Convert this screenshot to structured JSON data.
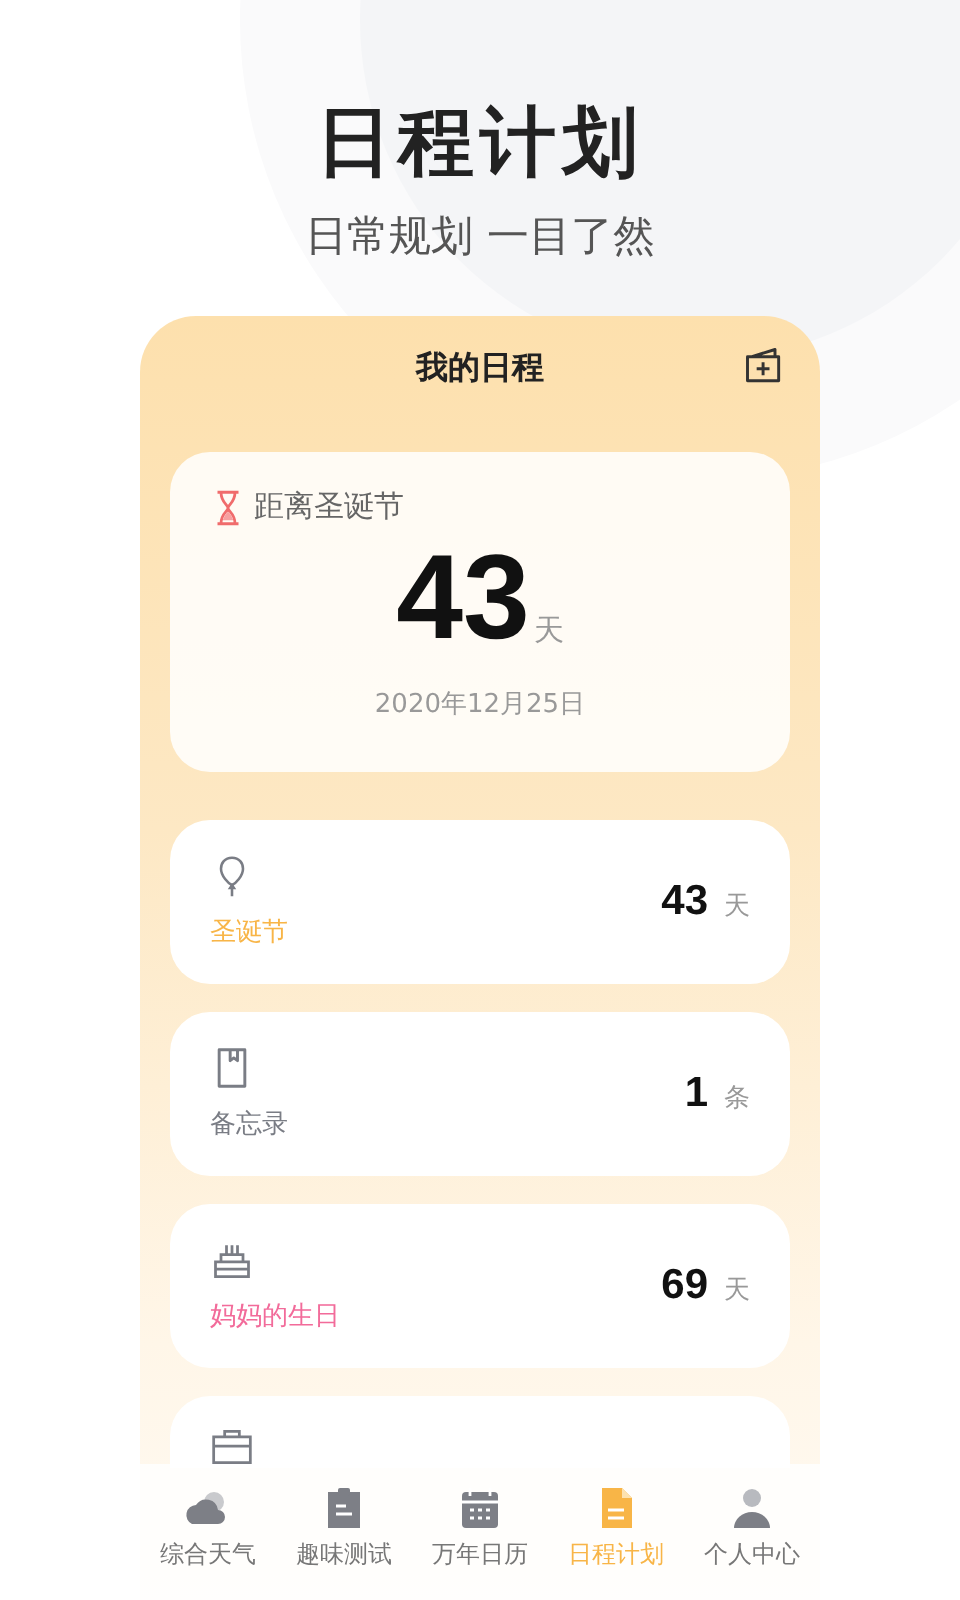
{
  "header": {
    "title": "日程计划",
    "subtitle": "日常规划 一目了然"
  },
  "phone": {
    "title": "我的日程",
    "countdown": {
      "label": "距离圣诞节",
      "number": "43",
      "unit": "天",
      "date": "2020年12月25日"
    },
    "events": [
      {
        "kind": "balloon",
        "name": "圣诞节",
        "color": "#f8b547",
        "count": "43",
        "unit": "天"
      },
      {
        "kind": "notebook",
        "name": "备忘录",
        "color": "#7a7d85",
        "count": "1",
        "unit": "条"
      },
      {
        "kind": "cake",
        "name": "妈妈的生日",
        "color": "#f26b9a",
        "count": "69",
        "unit": "天"
      },
      {
        "kind": "briefcase"
      }
    ]
  },
  "nav": [
    {
      "kind": "cloud",
      "label": "综合天气",
      "selected": false
    },
    {
      "kind": "clipboard",
      "label": "趣味测试",
      "selected": false
    },
    {
      "kind": "calendar",
      "label": "万年日历",
      "selected": false
    },
    {
      "kind": "document",
      "label": "日程计划",
      "selected": true
    },
    {
      "kind": "person",
      "label": "个人中心",
      "selected": false
    }
  ]
}
